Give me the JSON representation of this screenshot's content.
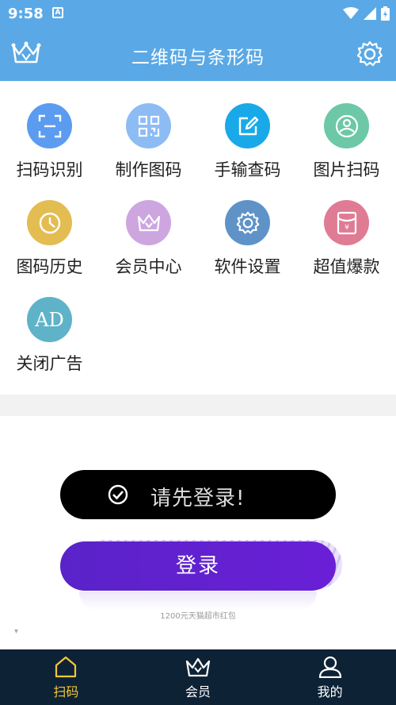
{
  "status_bar": {
    "time": "9:58",
    "notification_glyph": "A"
  },
  "app_bar": {
    "title": "二维码与条形码"
  },
  "features": [
    {
      "label": "扫码识别",
      "icon": "scan-frame-icon",
      "color": "#5b9cf0"
    },
    {
      "label": "制作图码",
      "icon": "qr-code-icon",
      "color": "#8dbcf4"
    },
    {
      "label": "手输查码",
      "icon": "edit-icon",
      "color": "#1aa9e8"
    },
    {
      "label": "图片扫码",
      "icon": "photo-icon",
      "color": "#6cc8a6"
    },
    {
      "label": "图码历史",
      "icon": "clock-icon",
      "color": "#e3bd52"
    },
    {
      "label": "会员中心",
      "icon": "crown-icon",
      "color": "#cda6e0"
    },
    {
      "label": "软件设置",
      "icon": "gear-icon",
      "color": "#5f93c8"
    },
    {
      "label": "超值爆款",
      "icon": "red-packet-icon",
      "color": "#e07b94"
    },
    {
      "label": "关闭广告",
      "icon": "ad-icon",
      "color": "#5fb3c8",
      "glyph": "AD"
    }
  ],
  "toast": {
    "message": "请先登录!"
  },
  "login": {
    "button_label": "登录",
    "promo_text": "1200元天猫超市红包"
  },
  "bottom_nav": [
    {
      "label": "扫码",
      "icon": "home-icon",
      "active": true
    },
    {
      "label": "会员",
      "icon": "crown-icon",
      "active": false
    },
    {
      "label": "我的",
      "icon": "user-icon",
      "active": false
    }
  ],
  "colors": {
    "app_bar": "#5aa9e6",
    "bottom_bar": "#0e2236",
    "active_tab": "#f2c63a",
    "login_button": "#5a23c9"
  }
}
